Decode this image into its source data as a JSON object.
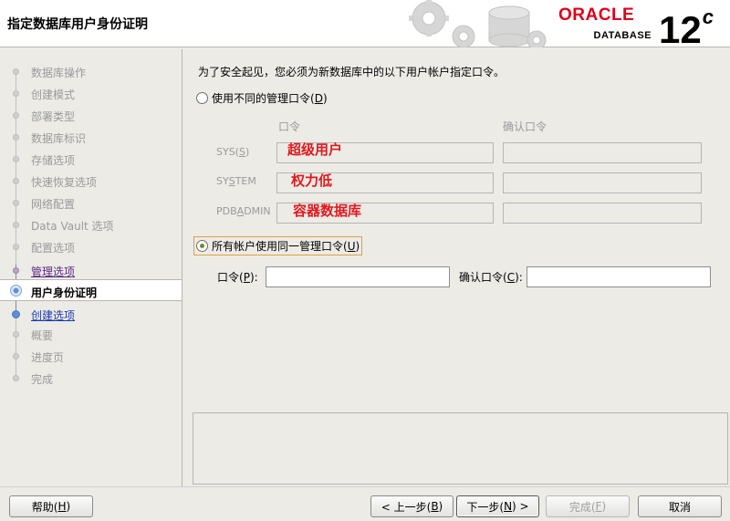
{
  "header": {
    "title": "指定数据库用户身份证明",
    "brand": "ORACLE",
    "product": "DATABASE",
    "version": "12",
    "version_suffix": "c"
  },
  "sidebar": {
    "steps": [
      {
        "label": "数据库操作",
        "state": "disabled"
      },
      {
        "label": "创建模式",
        "state": "disabled"
      },
      {
        "label": "部署类型",
        "state": "disabled"
      },
      {
        "label": "数据库标识",
        "state": "disabled"
      },
      {
        "label": "存储选项",
        "state": "disabled"
      },
      {
        "label": "快速恢复选项",
        "state": "disabled"
      },
      {
        "label": "网络配置",
        "state": "disabled"
      },
      {
        "label": "Data Vault 选项",
        "state": "disabled"
      },
      {
        "label": "配置选项",
        "state": "disabled"
      },
      {
        "label": "管理选项",
        "state": "done"
      },
      {
        "label": "用户身份证明",
        "state": "current"
      },
      {
        "label": "创建选项",
        "state": "next"
      },
      {
        "label": "概要",
        "state": "disabled"
      },
      {
        "label": "进度页",
        "state": "disabled"
      },
      {
        "label": "完成",
        "state": "disabled"
      }
    ]
  },
  "main": {
    "intro": "为了安全起见，您必须为新数据库中的以下用户帐户指定口令。",
    "option_different": {
      "label": "使用不同的管理口令(",
      "mnemonic": "D",
      "suffix": ")",
      "checked": false
    },
    "columns": {
      "password": "口令",
      "confirm": "确认口令"
    },
    "accounts": [
      {
        "name_pre": "SYS(",
        "mnemonic": "S",
        "name_post": ")",
        "annotation": "超级用户"
      },
      {
        "name_pre": "SY",
        "mnemonic": "S",
        "name_post": "TEM",
        "annotation": "权力低"
      },
      {
        "name_pre": "PDB",
        "mnemonic": "A",
        "name_post": "DMIN",
        "annotation": "容器数据库"
      }
    ],
    "option_same": {
      "label": "所有帐户使用同一管理口令(",
      "mnemonic": "U",
      "suffix": ")",
      "checked": true
    },
    "password": {
      "label_pre": "口令(",
      "mnemonic": "P",
      "label_post": "):",
      "value": ""
    },
    "confirm_password": {
      "label_pre": "确认口令(",
      "mnemonic": "C",
      "label_post": "):",
      "value": ""
    }
  },
  "footer": {
    "help": {
      "pre": "帮助(",
      "mnemonic": "H",
      "post": ")"
    },
    "back": {
      "pre": "< 上一步(",
      "mnemonic": "B",
      "post": ")"
    },
    "next": {
      "pre": "下一步(",
      "mnemonic": "N",
      "post": ") >"
    },
    "finish": {
      "pre": "完成(",
      "mnemonic": "F",
      "post": ")"
    },
    "cancel": "取消"
  },
  "colors": {
    "brand_red": "#e0001b",
    "annotation_red": "#e0191e",
    "current_step_blue": "#5c8fd6",
    "visited_step_purple": "#5a2a82"
  }
}
